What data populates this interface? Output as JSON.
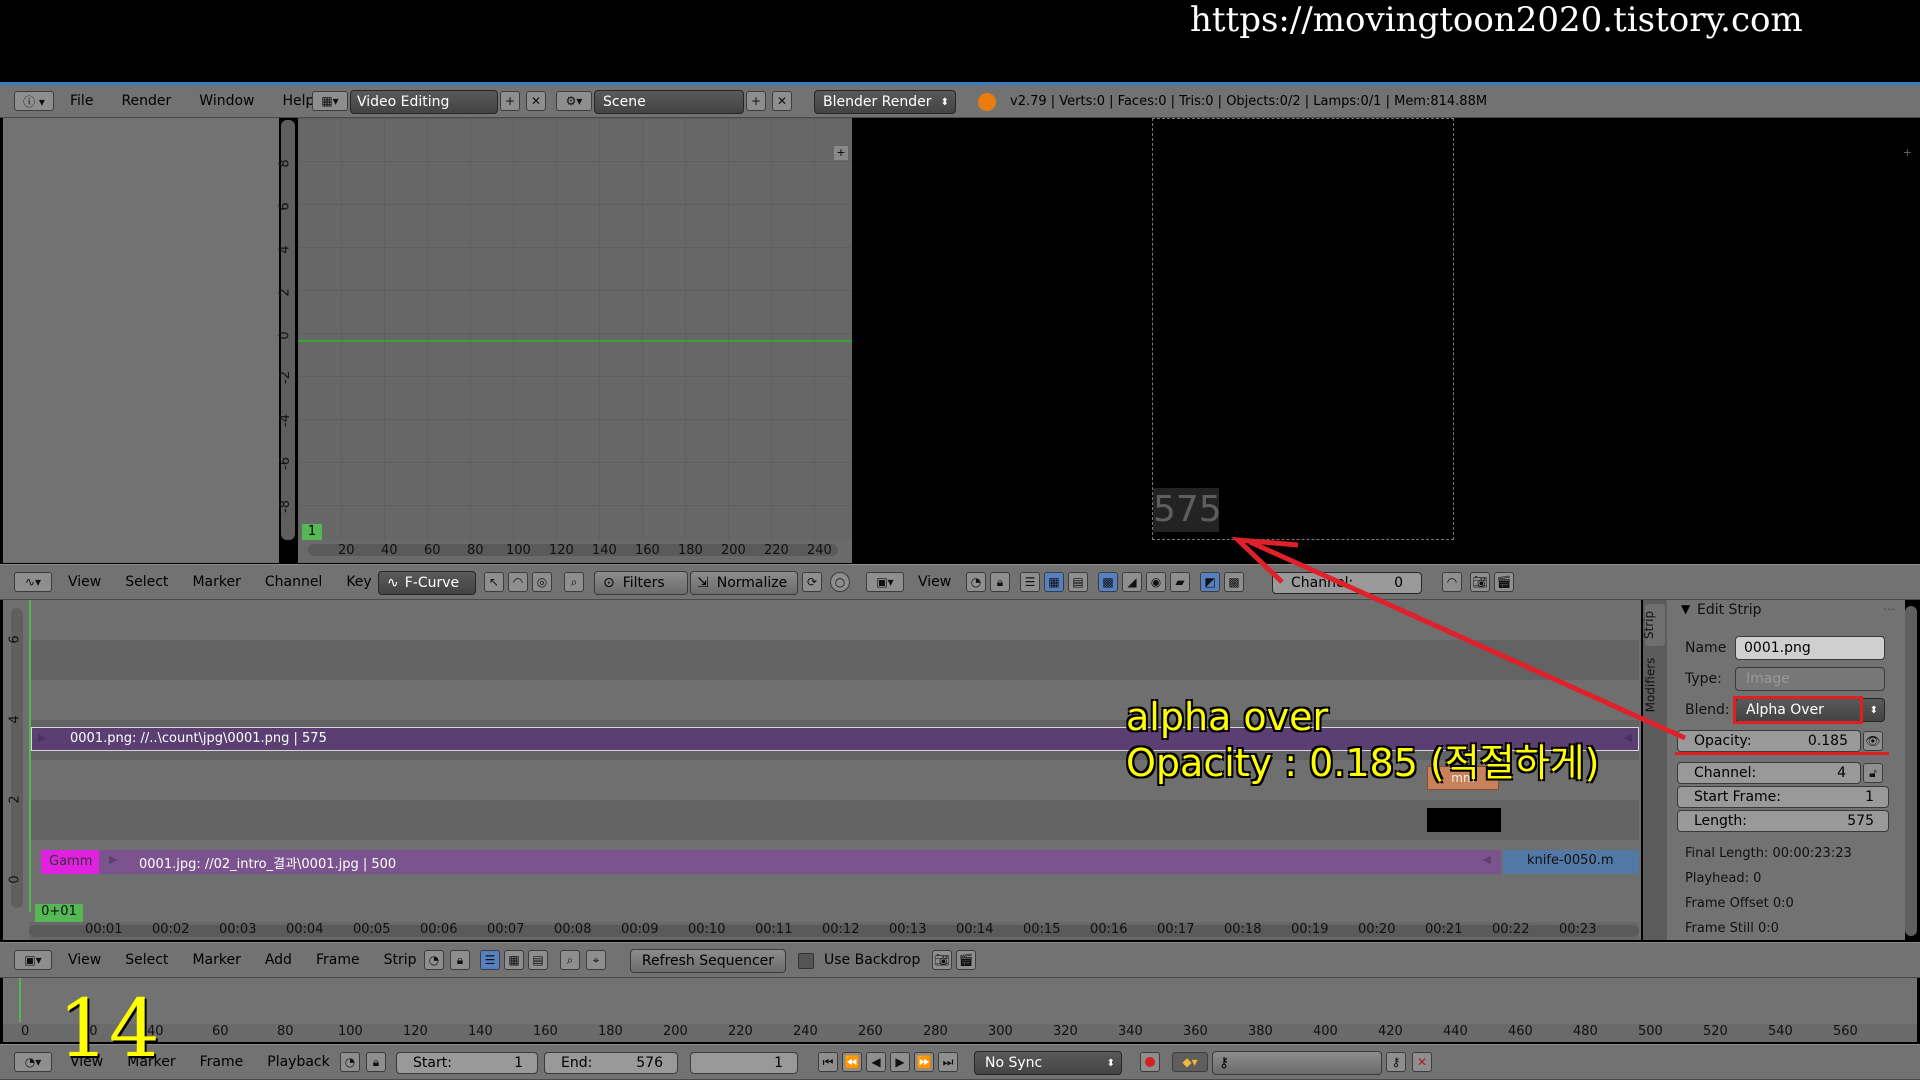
{
  "watermark": {
    "url": "https://movingtoon2020.tistory.com"
  },
  "info_header": {
    "menus": [
      "File",
      "Render",
      "Window",
      "Help"
    ],
    "screen_layout": "Video Editing",
    "scene": "Scene",
    "render_engine": "Blender Render",
    "stats": "v2.79 | Verts:0 | Faces:0 | Tris:0 | Objects:0/2 | Lamps:0/1 | Mem:814.88M"
  },
  "graph_editor": {
    "y_ticks": [
      "8",
      "6",
      "4",
      "2",
      "0",
      "-2",
      "-4",
      "-6",
      "-8"
    ],
    "x_ticks": [
      "20",
      "40",
      "60",
      "80",
      "100",
      "120",
      "140",
      "160",
      "180",
      "200",
      "220",
      "240"
    ],
    "current_frame": "1",
    "menus": [
      "View",
      "Select",
      "Marker",
      "Channel",
      "Key"
    ],
    "mode": "F-Curve",
    "filters_label": "Filters",
    "normalize_label": "Normalize"
  },
  "preview": {
    "frame_text": "575",
    "menus": [
      "View"
    ],
    "channel_label": "Channel:",
    "channel_value": "0"
  },
  "sequencer": {
    "channel_ticks": [
      "6",
      "4",
      "2",
      "0"
    ],
    "time_ticks": [
      "00:01",
      "00:02",
      "00:03",
      "00:04",
      "00:05",
      "00:06",
      "00:07",
      "00:08",
      "00:09",
      "00:10",
      "00:11",
      "00:12",
      "00:13",
      "00:14",
      "00:15",
      "00:16",
      "00:17",
      "00:18",
      "00:19",
      "00:20",
      "00:21",
      "00:22",
      "00:23"
    ],
    "current_time": "0+01",
    "strip_image_top": "0001.png: //..\\count\\jpg\\0001.png | 575",
    "strip_gamma": "Gamm",
    "strip_image_bottom": "0001.jpg: //02_intro_결과\\0001.jpg | 500",
    "strip_knife": "knife-0050.m",
    "small_strip": "mm",
    "menus": [
      "View",
      "Select",
      "Marker",
      "Add",
      "Frame",
      "Strip"
    ],
    "refresh_label": "Refresh Sequencer",
    "use_backdrop_label": "Use Backdrop"
  },
  "edit_strip": {
    "tabs": [
      "Strip",
      "Modifiers"
    ],
    "title": "Edit Strip",
    "name_label": "Name",
    "name_value": "0001.png",
    "type_label": "Type:",
    "type_value": "Image",
    "blend_label": "Blend:",
    "blend_value": "Alpha Over",
    "opacity_label": "Opacity:",
    "opacity_value": "0.185",
    "channel_label": "Channel:",
    "channel_value": "4",
    "start_label": "Start Frame:",
    "start_value": "1",
    "length_label": "Length:",
    "length_value": "575",
    "final_length": "Final Length: 00:00:23:23",
    "playhead": "Playhead: 0",
    "frame_offset": "Frame Offset 0:0",
    "frame_still": "Frame Still 0:0"
  },
  "annotation": {
    "line1": "alpha over",
    "line2": "Opacity : 0.185 (적절하게)",
    "color": "#ffff00",
    "arrow_color": "#e0202a"
  },
  "timeline": {
    "ticks": [
      "0",
      "20",
      "40",
      "60",
      "80",
      "100",
      "120",
      "140",
      "160",
      "180",
      "200",
      "220",
      "240",
      "260",
      "280",
      "300",
      "320",
      "340",
      "360",
      "380",
      "400",
      "420",
      "440",
      "460",
      "480",
      "500",
      "520",
      "540",
      "560"
    ],
    "menus": [
      "View",
      "Marker",
      "Frame",
      "Playback"
    ],
    "start_label": "Start:",
    "start_value": "1",
    "end_label": "End:",
    "end_value": "576",
    "current_frame": "1",
    "sync": "No Sync"
  },
  "step_number": "14"
}
